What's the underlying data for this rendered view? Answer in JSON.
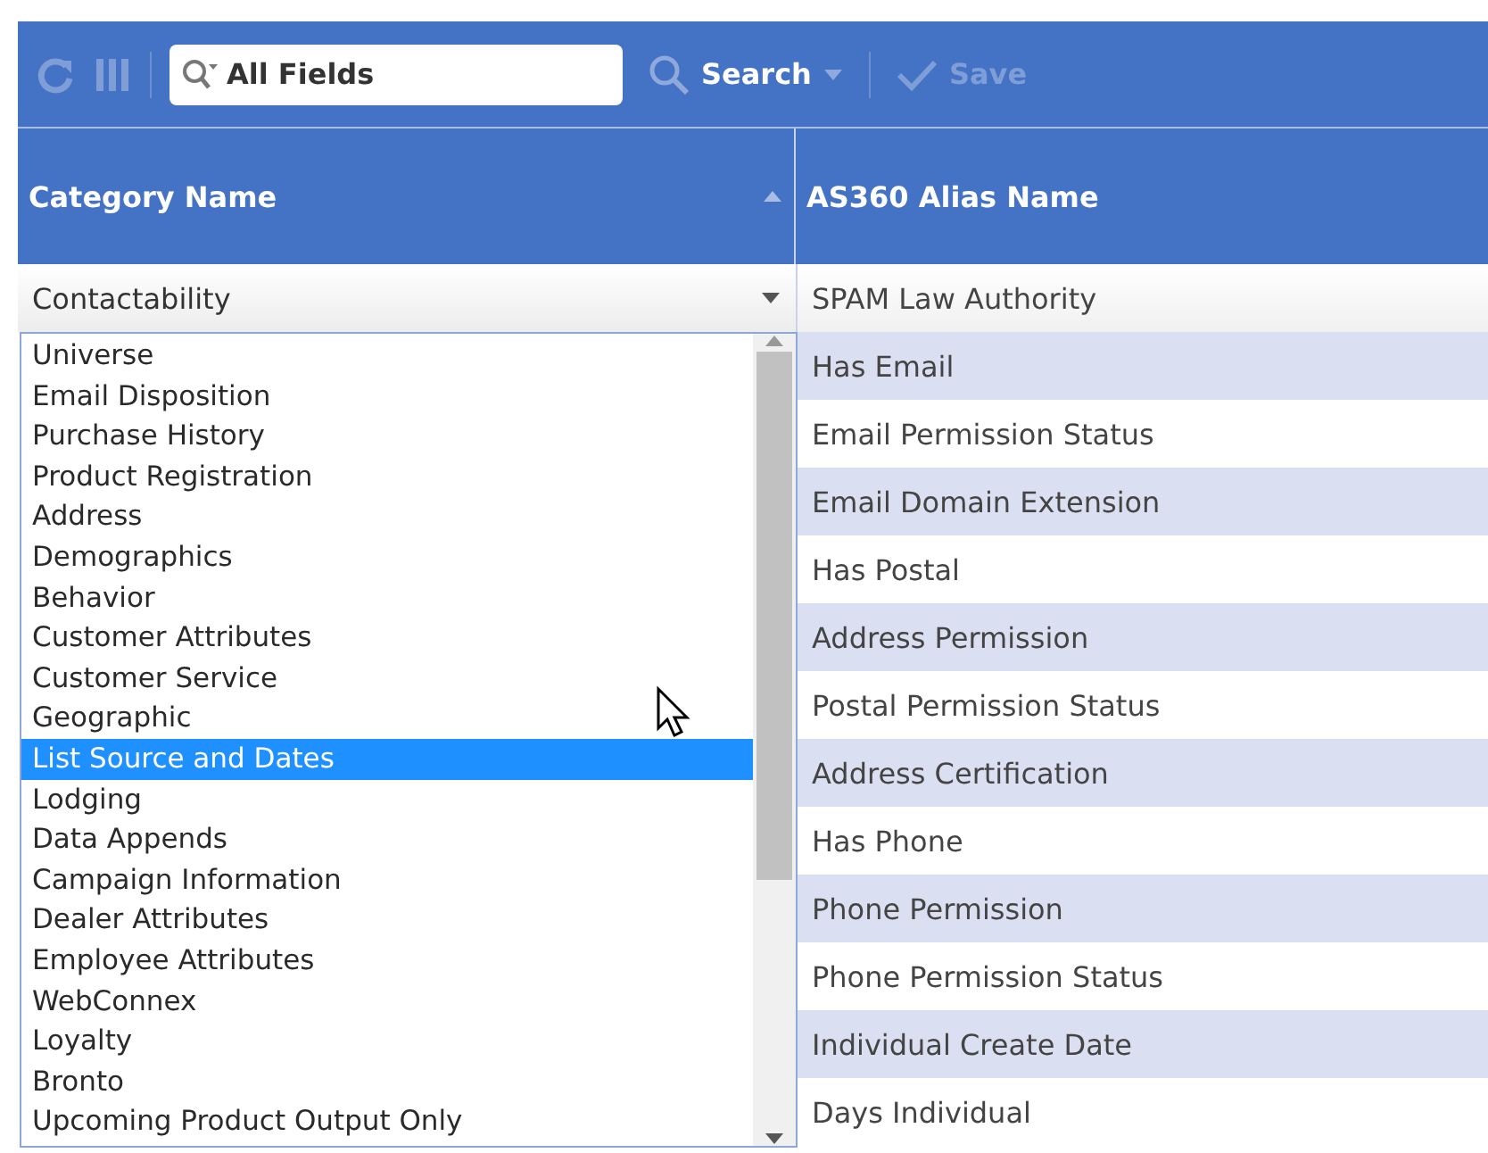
{
  "toolbar": {
    "items": [
      {
        "kind": "refresh",
        "disabled": true
      },
      {
        "kind": "columns",
        "disabled": true
      },
      {
        "kind": "separator"
      },
      {
        "kind": "field",
        "placeholder": "All Fields"
      },
      {
        "kind": "search",
        "label": "Search",
        "disabled": false
      },
      {
        "kind": "separator"
      },
      {
        "kind": "save",
        "label": "Save",
        "disabled": true
      }
    ]
  },
  "table": {
    "columns": [
      {
        "label": "Category Name",
        "sorted": true
      },
      {
        "label": "AS360 Alias Name",
        "sorted": false
      }
    ],
    "editor": {
      "value": "Contactability"
    },
    "dropdown": {
      "items": [
        {
          "label": "Universe",
          "selected": false
        },
        {
          "label": "Email Disposition",
          "selected": false
        },
        {
          "label": "Purchase History",
          "selected": false
        },
        {
          "label": "Product Registration",
          "selected": false
        },
        {
          "label": "Address",
          "selected": false
        },
        {
          "label": "Demographics",
          "selected": false
        },
        {
          "label": "Behavior",
          "selected": false
        },
        {
          "label": "Customer Attributes",
          "selected": false
        },
        {
          "label": "Customer Service",
          "selected": false
        },
        {
          "label": "Geographic",
          "selected": false
        },
        {
          "label": "List Source and Dates",
          "selected": true
        },
        {
          "label": "Lodging",
          "selected": false
        },
        {
          "label": "Data Appends",
          "selected": false
        },
        {
          "label": "Campaign Information",
          "selected": false
        },
        {
          "label": "Dealer Attributes",
          "selected": false
        },
        {
          "label": "Employee Attributes",
          "selected": false
        },
        {
          "label": "WebConnex",
          "selected": false
        },
        {
          "label": "Loyalty",
          "selected": false
        },
        {
          "label": "Bronto",
          "selected": false
        },
        {
          "label": "Upcoming Product Output Only",
          "selected": false
        }
      ]
    },
    "rows": [
      {
        "alias": "SPAM Law Authority",
        "editing": true
      },
      {
        "alias": "Has Email",
        "editing": false
      },
      {
        "alias": "Email Permission Status",
        "editing": false
      },
      {
        "alias": "Email Domain Extension",
        "editing": false
      },
      {
        "alias": "Has Postal",
        "editing": false
      },
      {
        "alias": "Address Permission",
        "editing": false
      },
      {
        "alias": "Postal Permission Status",
        "editing": false
      },
      {
        "alias": "Address Certification",
        "editing": false
      },
      {
        "alias": "Has Phone",
        "editing": false
      },
      {
        "alias": "Phone Permission",
        "editing": false
      },
      {
        "alias": "Phone Permission Status",
        "editing": false
      },
      {
        "alias": "Individual Create Date",
        "editing": false
      },
      {
        "alias": "Days Individual",
        "editing": false
      }
    ]
  }
}
